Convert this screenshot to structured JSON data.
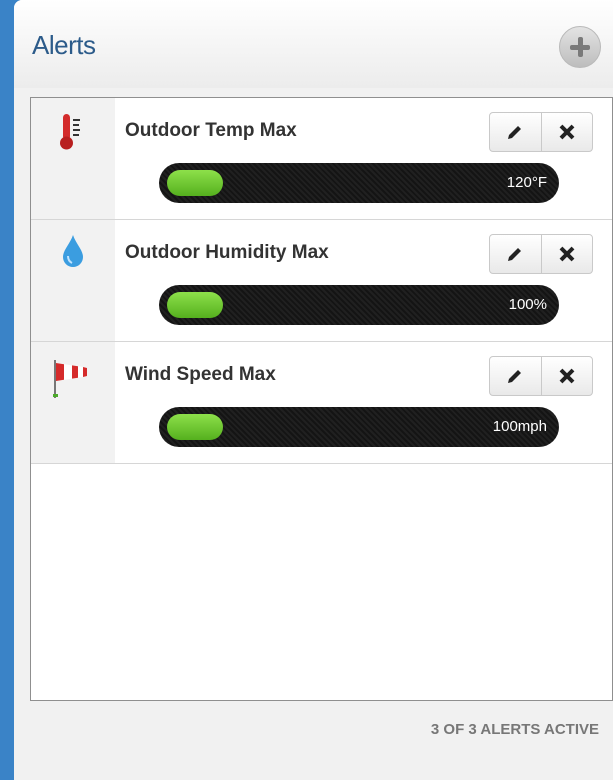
{
  "panel": {
    "title": "Alerts",
    "add_button": "plus-icon",
    "footer": "3 OF 3 ALERTS ACTIVE"
  },
  "colors": {
    "accent_blue": "#2c5b8a",
    "window_blue": "#3a83c7",
    "bar_fill_green": "#6cc833",
    "bar_track": "#1b1b1b"
  },
  "alerts": [
    {
      "name": "Outdoor Temp Max",
      "icon": "thermometer-icon",
      "value": "120°F",
      "level": 0.14
    },
    {
      "name": "Outdoor Humidity Max",
      "icon": "water-drop-icon",
      "value": "100%",
      "level": 0.14
    },
    {
      "name": "Wind Speed Max",
      "icon": "windsock-icon",
      "value": "100mph",
      "level": 0.14
    }
  ],
  "actions": {
    "edit": "pencil-icon",
    "delete": "close-icon"
  }
}
